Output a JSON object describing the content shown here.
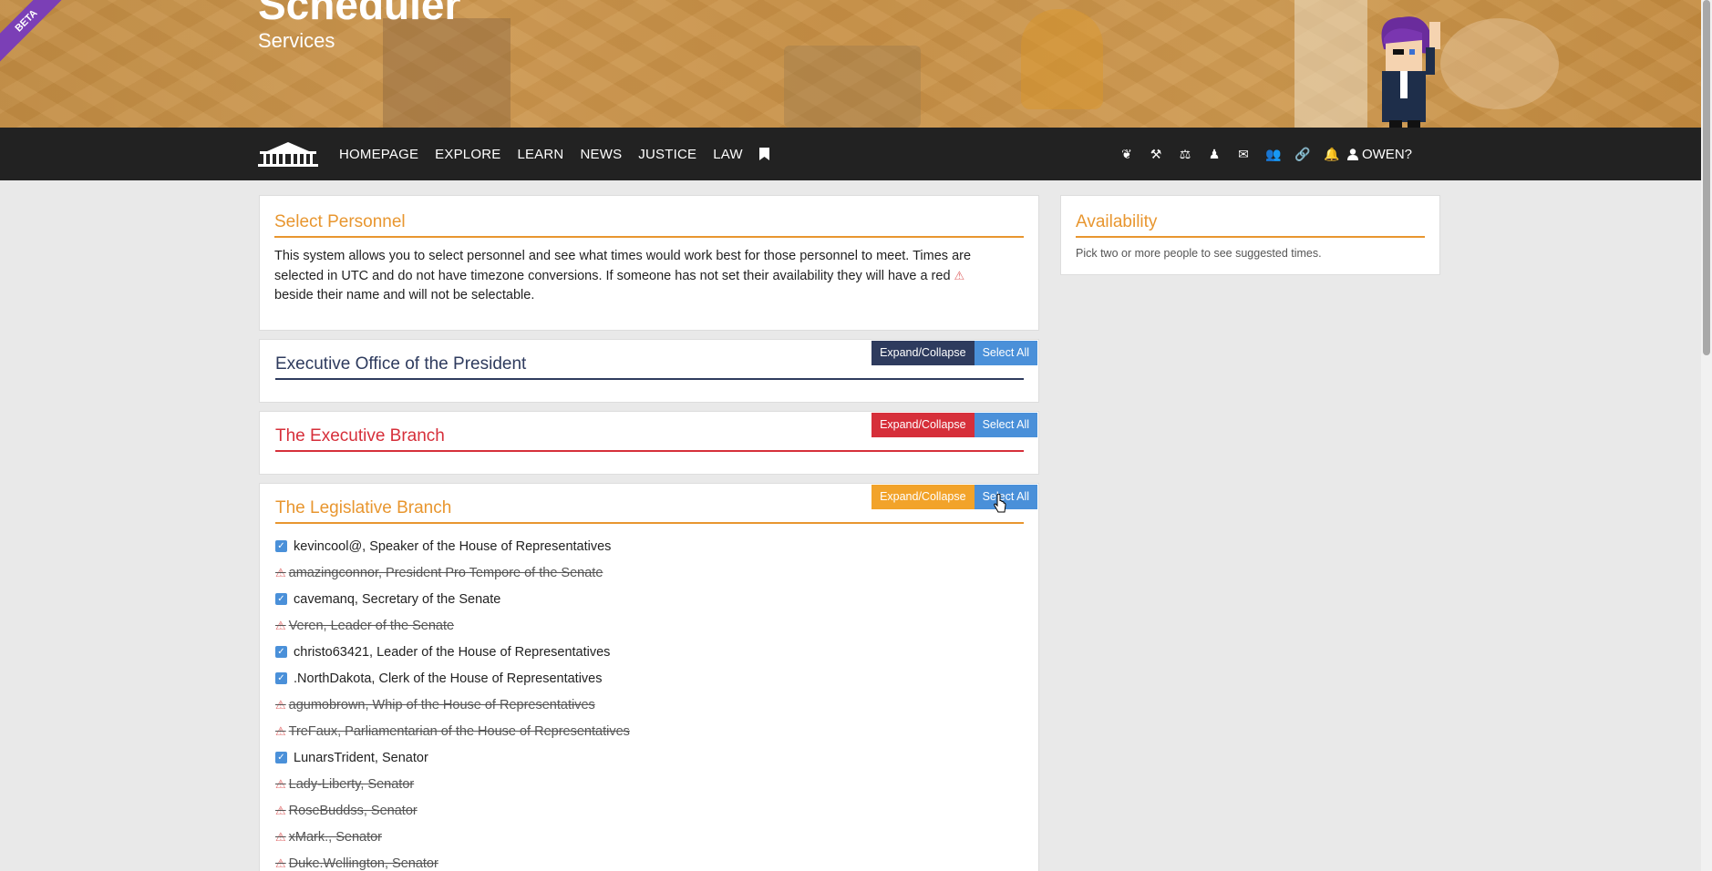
{
  "banner": {
    "badge": "BETA",
    "title": "Scheduler",
    "subtitle": "Services"
  },
  "nav": {
    "links": [
      "HOMEPAGE",
      "EXPLORE",
      "LEARN",
      "NEWS",
      "JUSTICE",
      "LAW"
    ],
    "right_icons": [
      "eagle-icon",
      "gavel-icon",
      "scales-icon",
      "chess-icon",
      "mail-icon",
      "group-icon",
      "link-icon",
      "bell-icon"
    ],
    "user_label": "OWEN?"
  },
  "select_personnel": {
    "title": "Select Personnel",
    "text_before_icon": "This system allows you to select personnel and see what times would work best for those personnel to meet. Times are selected in UTC and do not have timezone conversions. If someone has not set their availability they will have a red",
    "text_after_icon": "beside their name and will not be selectable."
  },
  "availability": {
    "title": "Availability",
    "hint": "Pick two or more people to see suggested times."
  },
  "branches": [
    {
      "title": "Executive Office of the President",
      "expand_label": "Expand/Collapse",
      "select_label": "Select All",
      "color": "#2e3b5e"
    },
    {
      "title": "The Executive Branch",
      "expand_label": "Expand/Collapse",
      "select_label": "Select All",
      "color": "#d62f3a"
    },
    {
      "title": "The Legislative Branch",
      "expand_label": "Expand/Collapse",
      "select_label": "Select All",
      "color": "#e8962f"
    }
  ],
  "legislative_members": [
    {
      "label": "kevincool@, Speaker of the House of Representatives",
      "available": true,
      "checked": true
    },
    {
      "label": "amazingconnor, President Pro Tempore of the Senate",
      "available": false
    },
    {
      "label": "cavemanq, Secretary of the Senate",
      "available": true,
      "checked": true
    },
    {
      "label": "Veren, Leader of the Senate",
      "available": false
    },
    {
      "label": "christo63421, Leader of the House of Representatives",
      "available": true,
      "checked": true
    },
    {
      "label": ".NorthDakota, Clerk of the House of Representatives",
      "available": true,
      "checked": true
    },
    {
      "label": "agumobrown, Whip of the House of Representatives",
      "available": false
    },
    {
      "label": "TreFaux, Parliamentarian of the House of Representatives",
      "available": false
    },
    {
      "label": "LunarsTrident, Senator",
      "available": true,
      "checked": true
    },
    {
      "label": "Lady-Liberty, Senator",
      "available": false
    },
    {
      "label": "RoseBuddss, Senator",
      "available": false
    },
    {
      "label": "xMark., Senator",
      "available": false
    },
    {
      "label": "Duke.Wellington, Senator",
      "available": false
    }
  ],
  "colors": {
    "accent_orange": "#e8962f",
    "nav_bg": "#222222",
    "select_all_blue": "#4a90d9",
    "beta_purple": "#7b3fb6"
  }
}
